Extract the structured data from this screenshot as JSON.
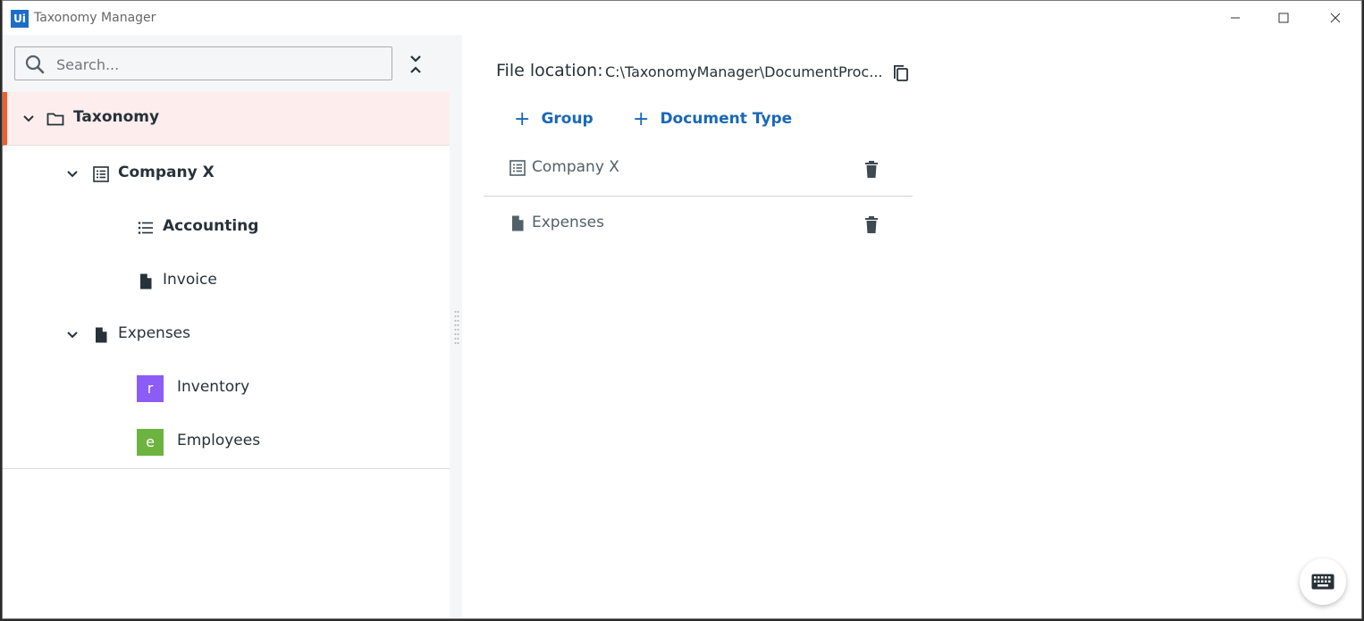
{
  "window": {
    "logo_text": "Ui",
    "title": "Taxonomy Manager",
    "icons": {
      "minimize": "minimize-icon",
      "maximize": "maximize-icon",
      "close": "close-icon"
    }
  },
  "search": {
    "placeholder": "Search...",
    "value": "",
    "icon": "search-icon"
  },
  "collapse_all_icon": "collapse-all-icon",
  "tree": {
    "root": {
      "label": "Taxonomy",
      "icon": "folder-icon",
      "expanded": true,
      "selected": true
    },
    "groups": [
      {
        "label": "Company X",
        "icon": "group-icon",
        "expanded": true,
        "children": [
          {
            "label": "Accounting",
            "icon": "category-list-icon"
          },
          {
            "label": "Invoice",
            "icon": "document-icon"
          }
        ]
      },
      {
        "label": "Expenses",
        "icon": "document-icon",
        "expanded": true,
        "children": [
          {
            "label": "Inventory",
            "badge": "r",
            "badge_color": "#8b5cf6"
          },
          {
            "label": "Employees",
            "badge": "e",
            "badge_color": "#6cb33f"
          }
        ]
      }
    ]
  },
  "details": {
    "file_location_label": "File location:",
    "file_location_path": "C:\\TaxonomyManager\\DocumentProc...",
    "copy_icon": "copy-icon",
    "add_group_label": "Group",
    "add_document_type_label": "Document Type",
    "items": [
      {
        "label": "Company X",
        "icon": "group-icon",
        "action_icon": "trash-icon"
      },
      {
        "label": "Expenses",
        "icon": "document-icon",
        "action_icon": "trash-icon"
      }
    ]
  },
  "keyboard_shortcuts_icon": "keyboard-icon",
  "colors": {
    "accent": "#f05e2a",
    "selected_bg": "#fdeeed",
    "link_blue": "#1a67b8",
    "logo_blue": "#1d6ec6"
  }
}
